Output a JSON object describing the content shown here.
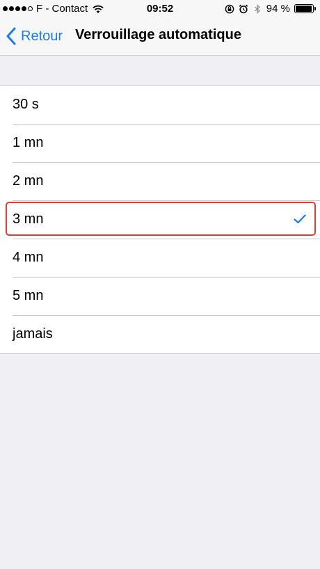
{
  "status_bar": {
    "carrier": "F - Contact",
    "time": "09:52",
    "battery_percent": "94 %",
    "battery_level": 0.94,
    "signal_bars_filled": 4,
    "signal_bars_total": 5,
    "icons": [
      "wifi-icon",
      "orientation-lock-icon",
      "alarm-icon",
      "bluetooth-icon",
      "battery-icon"
    ]
  },
  "nav": {
    "back_label": "Retour",
    "title": "Verrouillage automatique",
    "accent_color": "#1a7cf4"
  },
  "options": [
    {
      "label": "30 s",
      "selected": false
    },
    {
      "label": "1 mn",
      "selected": false
    },
    {
      "label": "2 mn",
      "selected": false
    },
    {
      "label": "3 mn",
      "selected": true
    },
    {
      "label": "4 mn",
      "selected": false
    },
    {
      "label": "5 mn",
      "selected": false
    },
    {
      "label": "jamais",
      "selected": false
    }
  ],
  "highlight_color": "#e53935"
}
